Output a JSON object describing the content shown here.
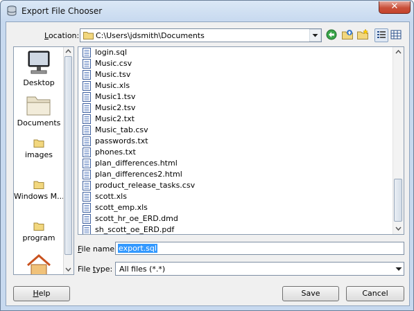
{
  "window": {
    "title": "Export File Chooser",
    "close_label": "✕"
  },
  "location": {
    "label": "Location:",
    "path": "C:\\Users\\jdsmith\\Documents"
  },
  "toolbar": {
    "icons": [
      "go-back-icon",
      "up-folder-icon",
      "new-folder-icon",
      "list-view-icon",
      "details-view-icon"
    ]
  },
  "places": [
    {
      "label": "Desktop",
      "icon": "desktop-icon"
    },
    {
      "label": "Documents",
      "icon": "documents-folder-icon"
    },
    {
      "label": "images",
      "icon": "folder-icon"
    },
    {
      "label": "Windows M...",
      "icon": "folder-icon"
    },
    {
      "label": "program",
      "icon": "folder-icon"
    },
    {
      "label": "",
      "icon": "home-icon"
    }
  ],
  "files": [
    "login.sql",
    "Music.csv",
    "Music.tsv",
    "Music.xls",
    "Music1.tsv",
    "Music2.tsv",
    "Music2.txt",
    "Music_tab.csv",
    "passwords.txt",
    "phones.txt",
    "plan_differences.html",
    "plan_differences2.html",
    "product_release_tasks.csv",
    "scott.xls",
    "scott_emp.xls",
    "scott_hr_oe_ERD.dmd",
    "sh_scott_oe_ERD.pdf"
  ],
  "file_name": {
    "label_mnemonic": "F",
    "label_rest": "ile name:",
    "value": "export.sql"
  },
  "file_type": {
    "label_pre": "File ",
    "label_mnemonic": "t",
    "label_rest": "ype:",
    "value": "All files (*.*)"
  },
  "buttons": {
    "help_mnemonic": "H",
    "help_rest": "elp",
    "save": "Save",
    "cancel": "Cancel"
  },
  "colors": {
    "selection": "#3399ff",
    "title_bar": "#c7d9ef",
    "close": "#c9503a"
  }
}
